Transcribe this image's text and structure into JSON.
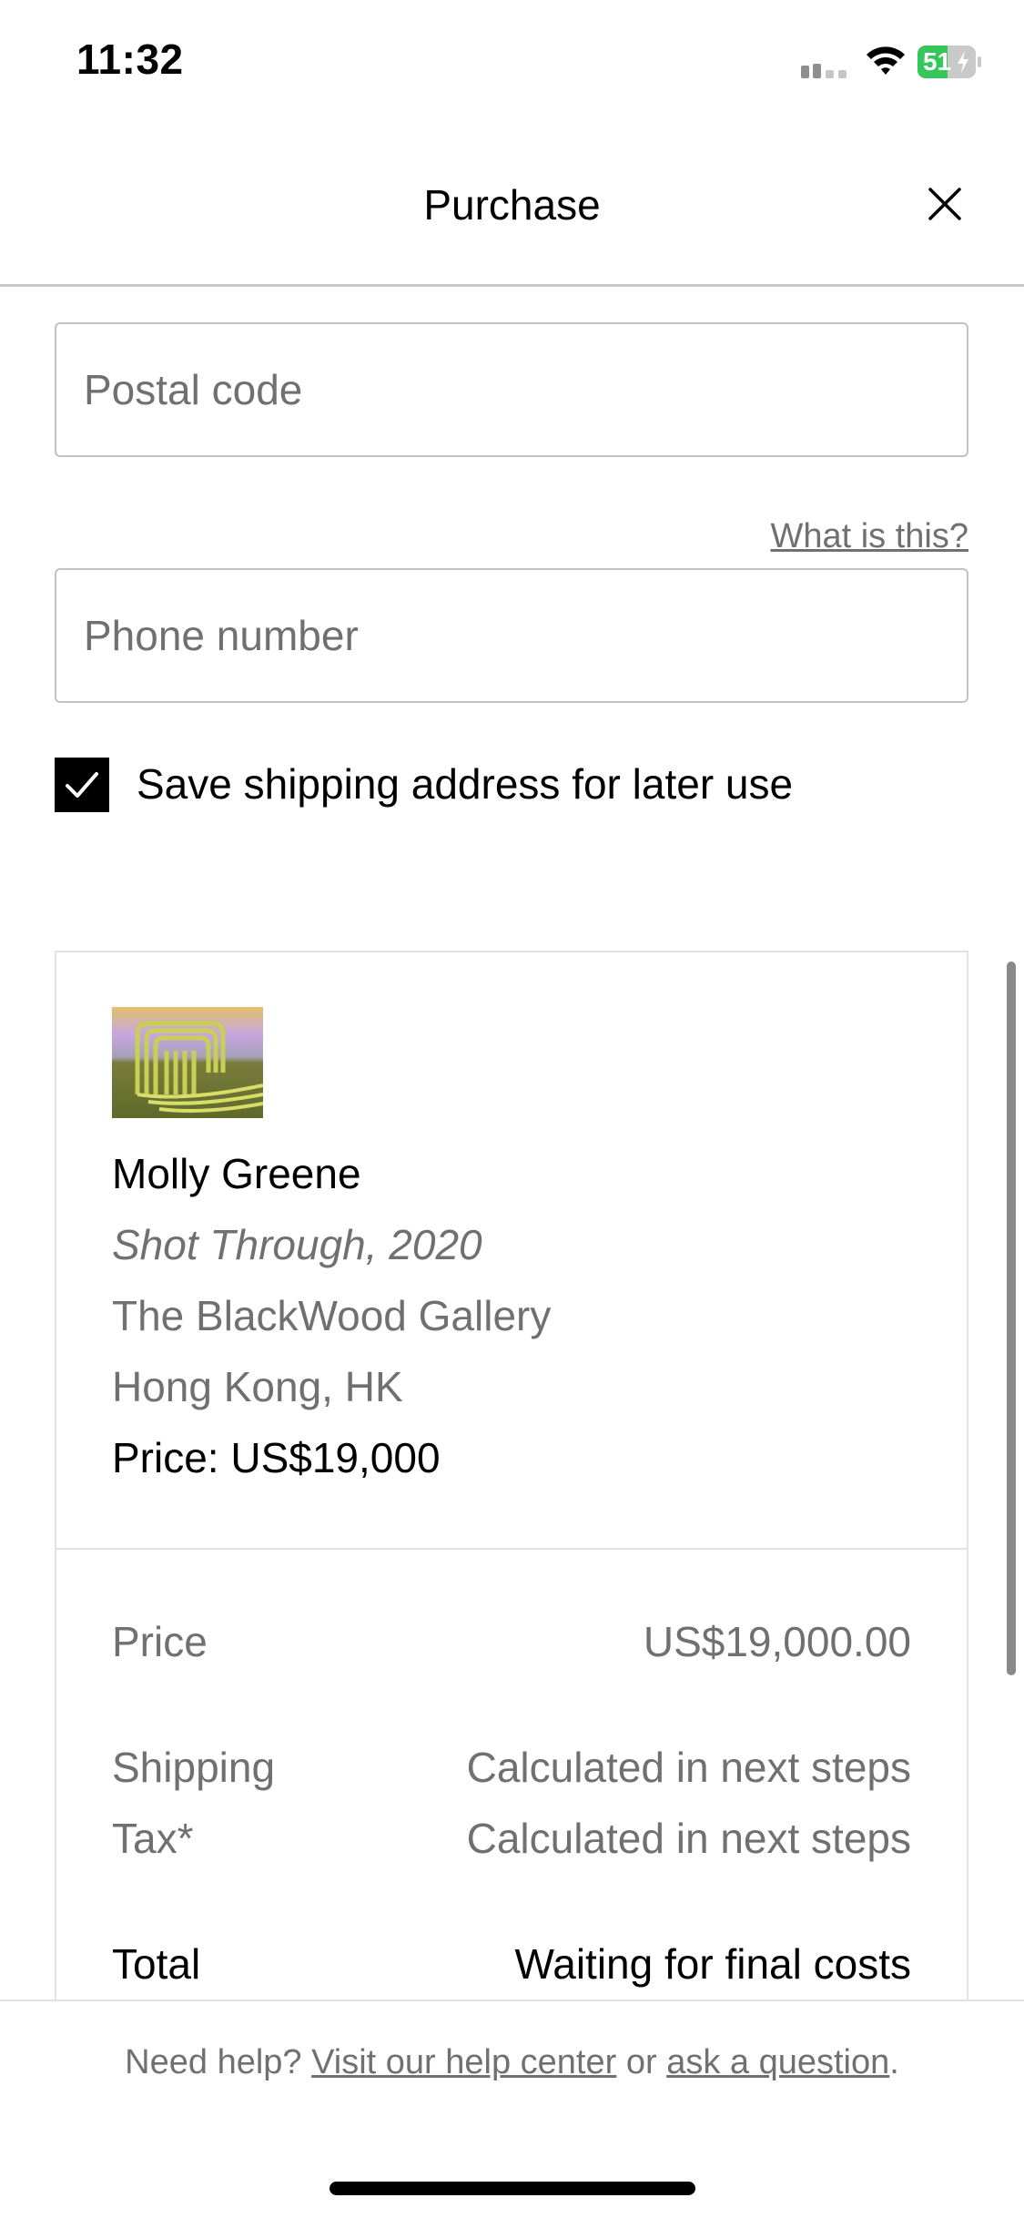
{
  "status_bar": {
    "time": "11:32",
    "battery_percent": "51",
    "battery_level": 0.51,
    "signal_icon": "cellular-signal-icon",
    "wifi_icon": "wifi-icon",
    "battery_icon": "battery-charging-icon"
  },
  "header": {
    "title": "Purchase",
    "close_icon": "close-icon"
  },
  "form": {
    "postal_code": {
      "placeholder": "Postal code",
      "value": ""
    },
    "phone_help_link": "What is this?",
    "phone_number": {
      "placeholder": "Phone number",
      "value": ""
    },
    "save_address": {
      "label": "Save shipping address for later use",
      "checked": true
    }
  },
  "artwork": {
    "thumbnail": "artwork-thumbnail",
    "artist": "Molly Greene",
    "title": "Shot Through, 2020",
    "gallery": "The BlackWood Gallery",
    "location": "Hong Kong, HK",
    "price_line": "Price: US$19,000"
  },
  "summary": {
    "price_label": "Price",
    "price_value": "US$19,000.00",
    "shipping_label": "Shipping",
    "shipping_value": "Calculated in next steps",
    "tax_label": "Tax*",
    "tax_value": "Calculated in next steps",
    "total_label": "Total",
    "total_value": "Waiting for final costs"
  },
  "footer": {
    "prefix": "Need help?",
    "help_center_link": "Visit our help center",
    "or_text": "or",
    "ask_link": "ask a question",
    "suffix": "."
  },
  "colors": {
    "secondary_text": "#707070",
    "border": "#c2c2c2",
    "battery_green": "#35c759"
  }
}
